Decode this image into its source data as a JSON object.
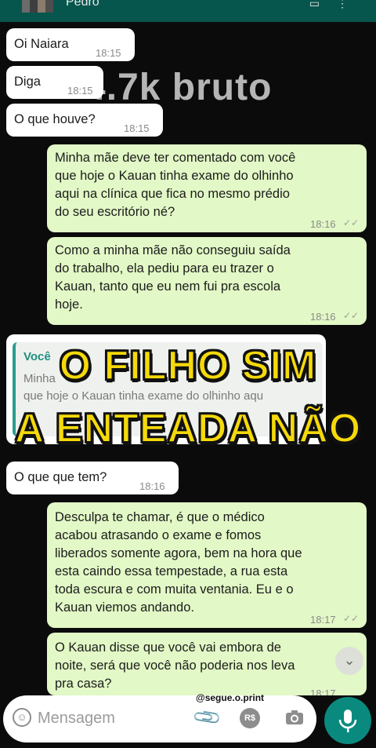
{
  "header": {
    "contact_name": "Pedro"
  },
  "background_text": "4.7k bruto",
  "messages": [
    {
      "id": "m1",
      "dir": "in",
      "text": "Oi Naiara",
      "time": "18:15"
    },
    {
      "id": "m2",
      "dir": "in",
      "text": "Diga",
      "time": "18:15"
    },
    {
      "id": "m3",
      "dir": "in",
      "text": "O que houve?",
      "time": "18:15"
    },
    {
      "id": "m4",
      "dir": "out",
      "lines": [
        "Minha mãe deve ter comentado com você",
        "que hoje o Kauan tinha exame do olhinho",
        "aqui na clínica que fica no mesmo prédio",
        "do seu escritório né?"
      ],
      "time": "18:16"
    },
    {
      "id": "m5",
      "dir": "out",
      "lines": [
        "Como a minha mãe não conseguiu saída",
        "do trabalho, ela pediu para eu trazer o",
        "Kauan, tanto que eu nem fui pra escola",
        "hoje."
      ],
      "time": "18:16"
    },
    {
      "id": "m6",
      "dir": "in",
      "text": "O que que tem?",
      "time": "18:16"
    },
    {
      "id": "m7",
      "dir": "out",
      "lines": [
        "Desculpa te chamar, é que o médico",
        "acabou atrasando o exame e fomos",
        "liberados somente agora, bem na hora que",
        "esta caindo essa tempestade, a rua esta",
        "toda escura e com muita ventania. Eu e o",
        "Kauan viemos andando."
      ],
      "time": "18:17"
    },
    {
      "id": "m8",
      "dir": "out",
      "lines": [
        "O Kauan disse que você vai embora de",
        "noite, será que você não poderia nos leva",
        "pra casa?"
      ],
      "time": "18:17"
    }
  ],
  "quoted": {
    "author": "Você",
    "line1": "Minha",
    "line2": "que hoje o Kauan tinha exame do olhinho aqu"
  },
  "overlay": {
    "line1": "O FILHO SIM",
    "line2": "A ENTEADA NÃO"
  },
  "input": {
    "placeholder": "Mensagem",
    "currency_icon_label": "R$"
  },
  "watermark": "@segue.o.print",
  "icons": [
    "emoji-icon",
    "attach-icon",
    "payment-icon",
    "camera-icon",
    "mic-icon",
    "scroll-down-icon"
  ],
  "colors": {
    "header": "#07564d",
    "outgoing": "#e2f8c6",
    "incoming": "#ffffff",
    "accent": "#0a8a7e",
    "overlay_text": "#f5d90a"
  }
}
